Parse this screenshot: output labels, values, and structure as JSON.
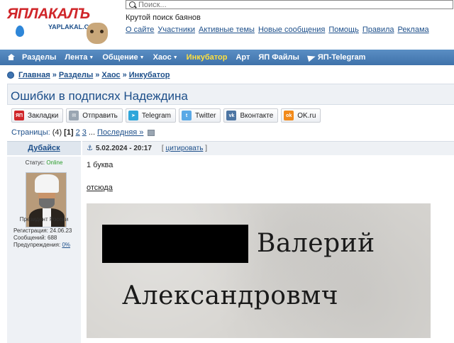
{
  "header": {
    "logo_text": "ЯПЛАКАЛЪ",
    "logo_sub": "YAPLAKAL.COM",
    "search_placeholder": "Поиск...",
    "tagline": "Крутой поиск баянов",
    "links": [
      "О сайте",
      "Участники",
      "Активные темы",
      "Новые сообщения",
      "Помощь",
      "Правила",
      "Реклама"
    ]
  },
  "nav": {
    "items": [
      {
        "label": "Разделы",
        "caret": false
      },
      {
        "label": "Лента",
        "caret": true
      },
      {
        "label": "Общение",
        "caret": true
      },
      {
        "label": "Хаос",
        "caret": true
      },
      {
        "label": "Инкубатор",
        "caret": false,
        "highlight": true
      },
      {
        "label": "Арт",
        "caret": false
      },
      {
        "label": "ЯП Файлы",
        "caret": false
      },
      {
        "label": "ЯП-Telegram",
        "caret": false
      }
    ],
    "bg_color": "#4a7fb8",
    "highlight_color": "#ffe040"
  },
  "breadcrumb": [
    "Главная",
    "Разделы",
    "Хаос",
    "Инкубатор"
  ],
  "topic": {
    "title": "Ошибки в подписях Надеждина"
  },
  "share": [
    {
      "label": "Закладки",
      "icon": "yap-icon",
      "color": "#d0262a",
      "glyph": "ЯП"
    },
    {
      "label": "Отправить",
      "icon": "mail-icon",
      "color": "#9aa6b2",
      "glyph": "✉"
    },
    {
      "label": "Telegram",
      "icon": "telegram-icon",
      "color": "#2ea6da",
      "glyph": "➤"
    },
    {
      "label": "Twitter",
      "icon": "twitter-icon",
      "color": "#5aa9e6",
      "glyph": "t"
    },
    {
      "label": "Вконтакте",
      "icon": "vk-icon",
      "color": "#4c75a3",
      "glyph": "vk"
    },
    {
      "label": "OK.ru",
      "icon": "ok-icon",
      "color": "#f28a1a",
      "glyph": "ok"
    }
  ],
  "pagination": {
    "label": "Страницы:",
    "total": "(4)",
    "current": "[1]",
    "pages": [
      "2",
      "3"
    ],
    "ellipsis": "...",
    "last": "Последняя »"
  },
  "post": {
    "author": "Дубайск",
    "status_label": "Статус:",
    "status_value": "Online",
    "status_color": "#2a9d2a",
    "rank": "Президент России",
    "reg_label": "Регистрация:",
    "reg_value": "24.06.23",
    "msgs_label": "Сообщений:",
    "msgs_value": "688",
    "warn_label": "Предупреждения:",
    "warn_value": "0%",
    "date": "5.02.2024 - 20:17",
    "cite": "цитировать",
    "text": "1 буква",
    "source_link": "отсюда",
    "image_line1": "Валерий",
    "image_line2": "Александровмч"
  }
}
